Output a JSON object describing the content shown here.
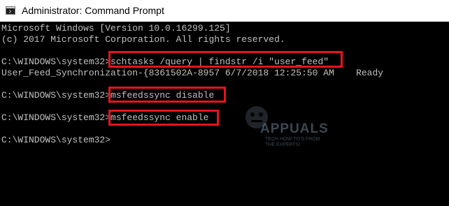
{
  "window": {
    "title": "Administrator: Command Prompt",
    "icon": "cmd-icon"
  },
  "console": {
    "lines": [
      "Microsoft Windows [Version 10.0.16299.125]",
      "(c) 2017 Microsoft Corporation. All rights reserved.",
      "",
      "C:\\WINDOWS\\system32>schtasks /query | findstr /i \"user_feed\"",
      "User_Feed_Synchronization-{8361502A-8957 6/7/2018 12:25:50 AM    Ready",
      "",
      "C:\\WINDOWS\\system32>msfeedssync disable",
      "",
      "C:\\WINDOWS\\system32>msfeedssync enable",
      "",
      "C:\\WINDOWS\\system32>"
    ]
  },
  "watermark": {
    "brand": "APPUALS",
    "tagline_1": "TECH HOW-TO'S FROM",
    "tagline_2": "THE EXPERTS!"
  },
  "colors": {
    "console_bg": "#000000",
    "console_text": "#c0c0c0",
    "highlight": "#e8141b",
    "titlebar_bg": "#ffffff"
  }
}
